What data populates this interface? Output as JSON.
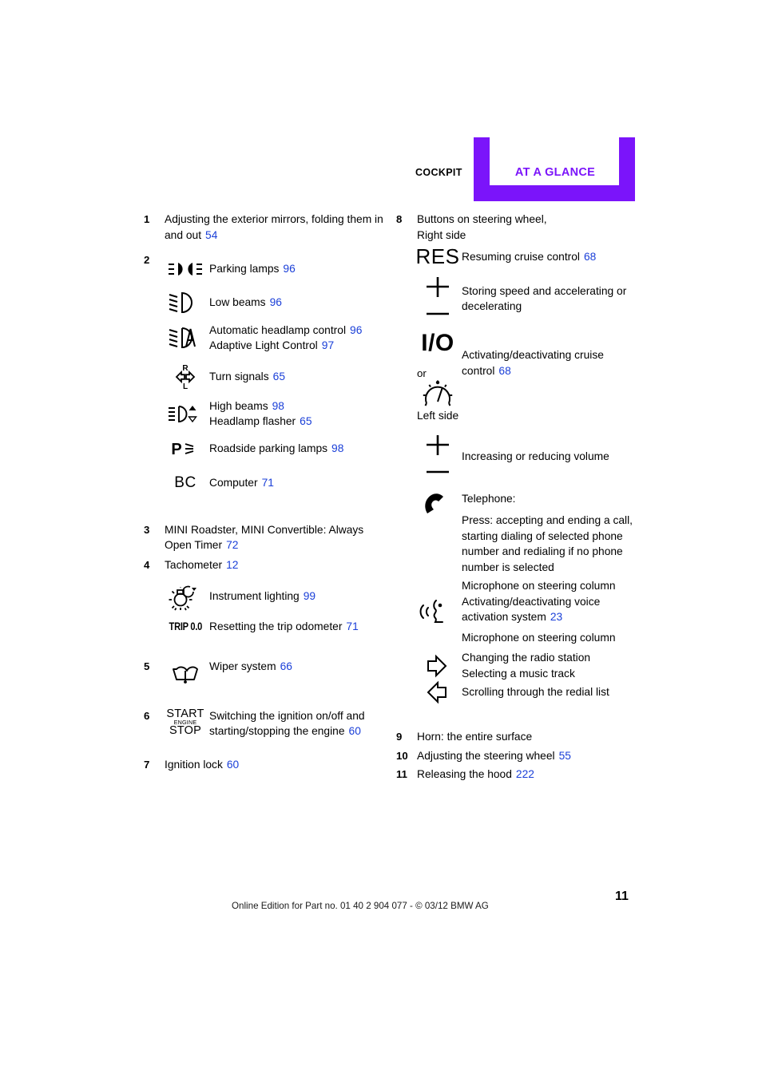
{
  "colors": {
    "accent": "#7B14FA",
    "reference_blue": "#1a3fd8",
    "text": "#000000"
  },
  "header": {
    "left_label": "COCKPIT",
    "right_label": "AT A GLANCE"
  },
  "left_column": [
    {
      "number": "1",
      "text": "Adjusting the exterior mirrors, folding them in and out",
      "ref": "54"
    },
    {
      "number": "2",
      "icon_entries": [
        {
          "icon": "parking-lamps-icon",
          "lines": [
            {
              "text": "Parking lamps",
              "ref": "96"
            }
          ]
        },
        {
          "icon": "low-beams-icon",
          "lines": [
            {
              "text": "Low beams",
              "ref": "96"
            }
          ]
        },
        {
          "icon": "automatic-headlamp-control-icon",
          "lines": [
            {
              "text": "Automatic headlamp control",
              "ref": "96"
            },
            {
              "text": "Adaptive Light Control",
              "ref": "97"
            }
          ]
        },
        {
          "icon": "turn-signals-icon",
          "lines": [
            {
              "text": "Turn signals",
              "ref": "65"
            }
          ]
        },
        {
          "icon": "high-beams-icon",
          "lines": [
            {
              "text": "High beams",
              "ref": "98"
            },
            {
              "text": "Headlamp flasher",
              "ref": "65"
            }
          ]
        },
        {
          "icon": "roadside-parking-lamps-icon",
          "lines": [
            {
              "text": "Roadside parking lamps",
              "ref": "98"
            }
          ]
        },
        {
          "icon": "computer-bc-icon",
          "glyph": "BC",
          "lines": [
            {
              "text": "Computer",
              "ref": "71"
            }
          ]
        }
      ]
    },
    {
      "number": "3",
      "text": "MINI Roadster, MINI Convertible: Always Open Timer",
      "ref": "72"
    },
    {
      "number": "4",
      "text": "Tachometer",
      "ref": "12",
      "icon_entries": [
        {
          "icon": "instrument-lighting-icon",
          "lines": [
            {
              "text": "Instrument lighting",
              "ref": "99"
            }
          ]
        },
        {
          "icon": "trip-odometer-icon",
          "glyph": "TRIP 0.0",
          "lines": [
            {
              "text": "Resetting the trip odometer",
              "ref": "71"
            }
          ]
        }
      ]
    },
    {
      "number": "5",
      "icon_entries": [
        {
          "icon": "wiper-system-icon",
          "lines": [
            {
              "text": "Wiper system",
              "ref": "66"
            }
          ]
        }
      ]
    },
    {
      "number": "6",
      "icon_entries": [
        {
          "icon": "start-stop-engine-icon",
          "glyph_top": "START",
          "glyph_mid": "ENGINE",
          "glyph_bottom": "STOP",
          "lines": [
            {
              "text": "Switching the ignition on/off and",
              "ref": ""
            },
            {
              "text": "starting/stopping the engine",
              "ref": "60"
            }
          ]
        }
      ]
    },
    {
      "number": "7",
      "text": "Ignition lock",
      "ref": "60"
    }
  ],
  "right_column": {
    "item8": {
      "number": "8",
      "title_line1": "Buttons on steering wheel,",
      "title_line2": "Right side",
      "entries": [
        {
          "icon": "res-button-icon",
          "glyph": "RES",
          "lines": [
            {
              "text": "Resuming cruise control",
              "ref": "68"
            }
          ]
        },
        {
          "icon": "plus-minus-icon",
          "lines": [
            {
              "text": "Storing speed and accelerating or",
              "ref": ""
            },
            {
              "text": "decelerating",
              "ref": ""
            }
          ]
        },
        {
          "icon": "io-button-icon",
          "glyph": "I/O",
          "or_label": "or",
          "alt_icon": "speedometer-icon",
          "lines": [
            {
              "text": "Activating/deactivating cruise",
              "ref": ""
            },
            {
              "text": "control",
              "ref": "68"
            }
          ]
        }
      ],
      "left_side_label": "Left side",
      "left_side_entries": [
        {
          "icon": "plus-minus-icon",
          "lines": [
            {
              "text": "Increasing or reducing volume",
              "ref": ""
            }
          ]
        },
        {
          "icon": "telephone-icon",
          "lines": [
            {
              "text": "Telephone:",
              "ref": ""
            }
          ],
          "paragraph": [
            "Press: accepting and ending a call,",
            "starting dialing of selected phone",
            "number and redialing if no phone",
            "number is selected"
          ]
        },
        {
          "icon": "voice-activation-icon",
          "lines_before": [
            "Microphone on steering column"
          ],
          "lines": [
            {
              "text": "Activating/deactivating voice",
              "ref": ""
            },
            {
              "text": "activation system",
              "ref": "23"
            }
          ],
          "lines_after": [
            "Microphone on steering column"
          ]
        },
        {
          "icon": "arrow-right-icon",
          "lines": [
            {
              "text": "Changing the radio station",
              "ref": ""
            },
            {
              "text": "Selecting a music track",
              "ref": ""
            }
          ]
        },
        {
          "icon": "arrow-left-icon",
          "lines": [
            {
              "text": "Scrolling through the redial list",
              "ref": ""
            }
          ]
        }
      ]
    },
    "bottom_items": [
      {
        "number": "9",
        "text": "Horn: the entire surface",
        "ref": ""
      },
      {
        "number": "10",
        "text": "Adjusting the steering wheel",
        "ref": "55"
      },
      {
        "number": "11",
        "text": "Releasing the hood",
        "ref": "222"
      }
    ]
  },
  "footer": {
    "text": "Online Edition for Part no. 01 40 2 904 077 - © 03/12 BMW AG",
    "page_number": "11"
  }
}
